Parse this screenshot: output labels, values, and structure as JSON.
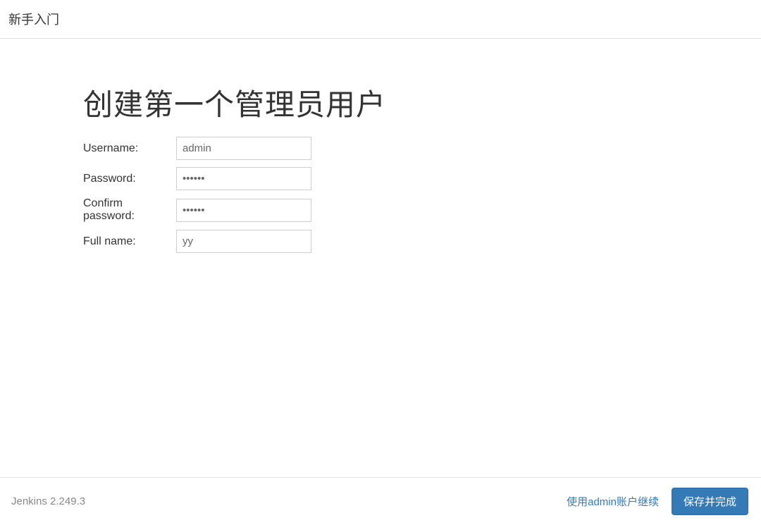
{
  "header": {
    "title": "新手入门"
  },
  "main": {
    "heading": "创建第一个管理员用户",
    "form": {
      "username": {
        "label": "Username:",
        "value": "admin"
      },
      "password": {
        "label": "Password:",
        "value": "••••••"
      },
      "confirm_password": {
        "label": "Confirm password:",
        "value": "••••••"
      },
      "fullname": {
        "label": "Full name:",
        "value": "yy"
      }
    }
  },
  "footer": {
    "version": "Jenkins 2.249.3",
    "continue_link": "使用admin账户继续",
    "save_button": "保存并完成"
  }
}
